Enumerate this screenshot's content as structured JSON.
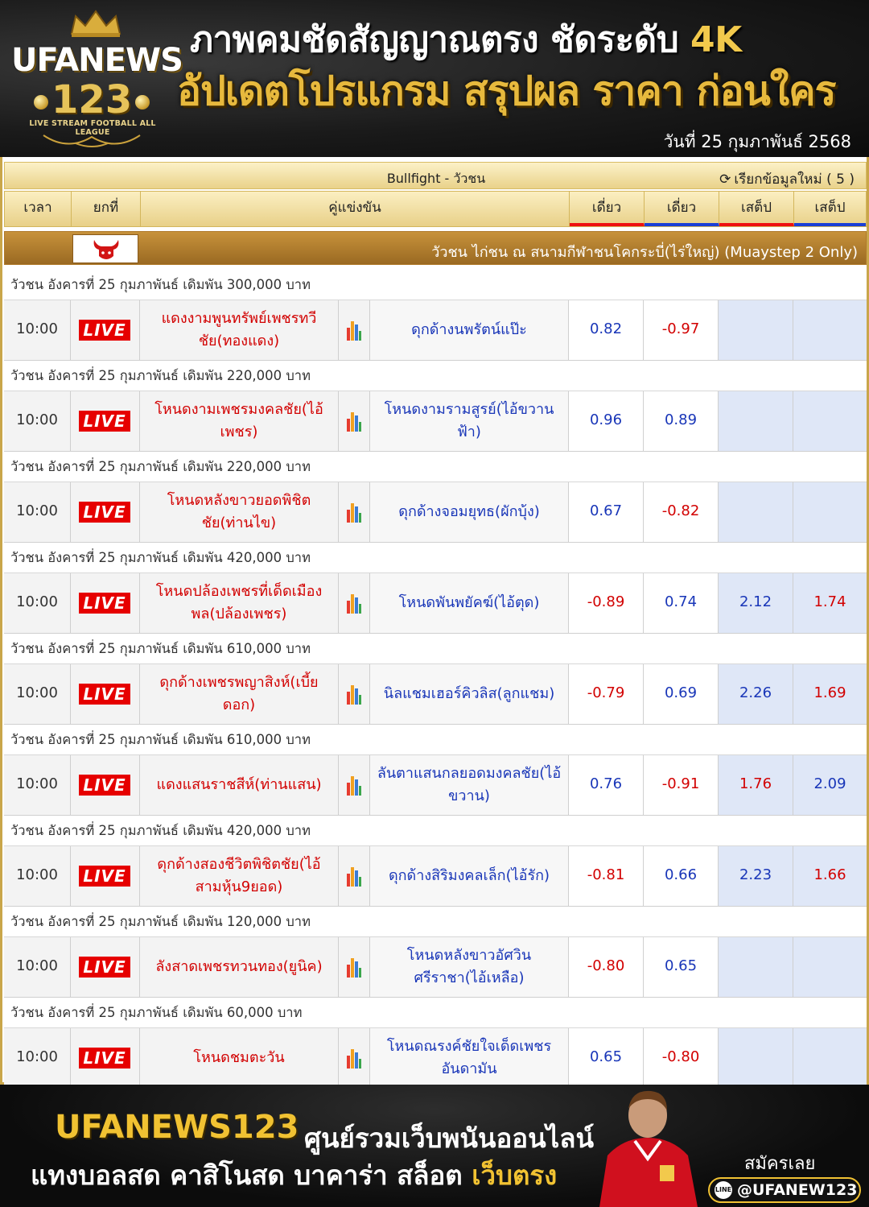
{
  "header": {
    "logo_name": "UFANEWS",
    "logo_number": "123",
    "logo_tagline": "LIVE STREAM FOOTBALL ALL LEAGUE",
    "headline1_main": "ภาพคมชัดสัญญาณตรง ชัดระดับ ",
    "headline1_accent": "4K",
    "headline2": "อัปเดตโปรแกรม สรุปผล ราคา ก่อนใคร",
    "date": "วันที่ 25 กุมภาพันธ์ 2568"
  },
  "table": {
    "title": "Bullfight - วัวชน",
    "refresh_label": "เรียกข้อมูลใหม่ ( 5 )",
    "columns": {
      "time": "เวลา",
      "round": "ยกที่",
      "match": "คู่แข่งขัน",
      "odds1": "เดี่ยว",
      "odds2": "เดี่ยว",
      "odds3": "เสต็ป",
      "odds4": "เสต็ป"
    },
    "league_name": "วัวชน ไก่ชน ณ สนามกีฬาชนโคกระบี่(ไร่ใหญ่) (Muaystep 2 Only)",
    "live_label": "LIVE",
    "matches": [
      {
        "group": "วัวชน อังคารที่ 25 กุมภาพันธ์ เดิมพัน 300,000 บาท",
        "time": "10:00",
        "home": "แดงงามพูนทรัพย์เพชรทวีชัย(ทองแดง)",
        "away": "ดุกด้างนพรัตน์แป๊ะ",
        "o1": "0.82",
        "o2": "-0.97",
        "o3": "",
        "o4": ""
      },
      {
        "group": "วัวชน อังคารที่ 25 กุมภาพันธ์ เดิมพัน 220,000 บาท",
        "time": "10:00",
        "home": "โหนดงามเพชรมงคลชัย(ไอ้เพชร)",
        "away": "โหนดงามรามสูรย์(ไอ้ขวานฟ้า)",
        "o1": "0.96",
        "o2": "0.89",
        "o3": "",
        "o4": ""
      },
      {
        "group": "วัวชน อังคารที่ 25 กุมภาพันธ์ เดิมพัน 220,000 บาท",
        "time": "10:00",
        "home": "โหนดหลังขาวยอดพิชิตชัย(ท่านไข)",
        "away": "ดุกด้างจอมยุทธ(ผักบุ้ง)",
        "o1": "0.67",
        "o2": "-0.82",
        "o3": "",
        "o4": ""
      },
      {
        "group": "วัวชน อังคารที่ 25 กุมภาพันธ์ เดิมพัน 420,000 บาท",
        "time": "10:00",
        "home": "โหนดปล้องเพชรที่เด็ดเมืองพล(ปล้องเพชร)",
        "away": "โหนดพันพยัคฆ์(ไอ้ตุด)",
        "o1": "-0.89",
        "o2": "0.74",
        "o3": "2.12",
        "o4": "1.74"
      },
      {
        "group": "วัวชน อังคารที่ 25 กุมภาพันธ์ เดิมพัน 610,000 บาท",
        "time": "10:00",
        "home": "ดุกด้างเพชรพญาสิงห์(เบี้ยดอก)",
        "away": "นิลแชมเฮอร์คิวลิส(ลูกแชม)",
        "o1": "-0.79",
        "o2": "0.69",
        "o3": "2.26",
        "o4": "1.69"
      },
      {
        "group": "วัวชน อังคารที่ 25 กุมภาพันธ์ เดิมพัน 610,000 บาท",
        "time": "10:00",
        "home": "แดงแสนราชสีห์(ท่านแสน)",
        "away": "ลันตาแสนกลยอดมงคลชัย(ไอ้ขวาน)",
        "o1": "0.76",
        "o2": "-0.91",
        "o3": "1.76",
        "o4": "2.09"
      },
      {
        "group": "วัวชน อังคารที่ 25 กุมภาพันธ์ เดิมพัน 420,000 บาท",
        "time": "10:00",
        "home": "ดุกด้างสองชีวิตพิชิตชัย(ไอ้สามหุ้น9ยอด)",
        "away": "ดุกด้างสิริมงคลเล็ก(ไอ้รัก)",
        "o1": "-0.81",
        "o2": "0.66",
        "o3": "2.23",
        "o4": "1.66"
      },
      {
        "group": "วัวชน อังคารที่ 25 กุมภาพันธ์ เดิมพัน 120,000 บาท",
        "time": "10:00",
        "home": "ลังสาดเพชรทวนทอง(ยูนิค)",
        "away": "โหนดหลังขาวอัศวินศรีราชา(ไอ้เหลือ)",
        "o1": "-0.80",
        "o2": "0.65",
        "o3": "",
        "o4": ""
      },
      {
        "group": "วัวชน อังคารที่ 25 กุมภาพันธ์ เดิมพัน 60,000 บาท",
        "time": "10:00",
        "home": "โหนดชมตะวัน",
        "away": "โหนดณรงค์ชัยใจเด็ดเพชรอันดามัน",
        "o1": "0.65",
        "o2": "-0.80",
        "o3": "",
        "o4": ""
      }
    ]
  },
  "footer": {
    "brand": "UFANEWS123",
    "subtitle": "ศูนย์รวมเว็บพนันออนไลน์",
    "line2_main": "แทงบอลสด คาสิโนสด บาคาร่า สล็อต ",
    "line2_accent": "เว็บตรง",
    "join_label": "สมัครเลย",
    "line_id": "@UFANEW123"
  },
  "colors": {
    "gold": "#e7b93d",
    "home_team": "#d20000",
    "away_team": "#1936b8",
    "live_badge": "#e60000"
  }
}
